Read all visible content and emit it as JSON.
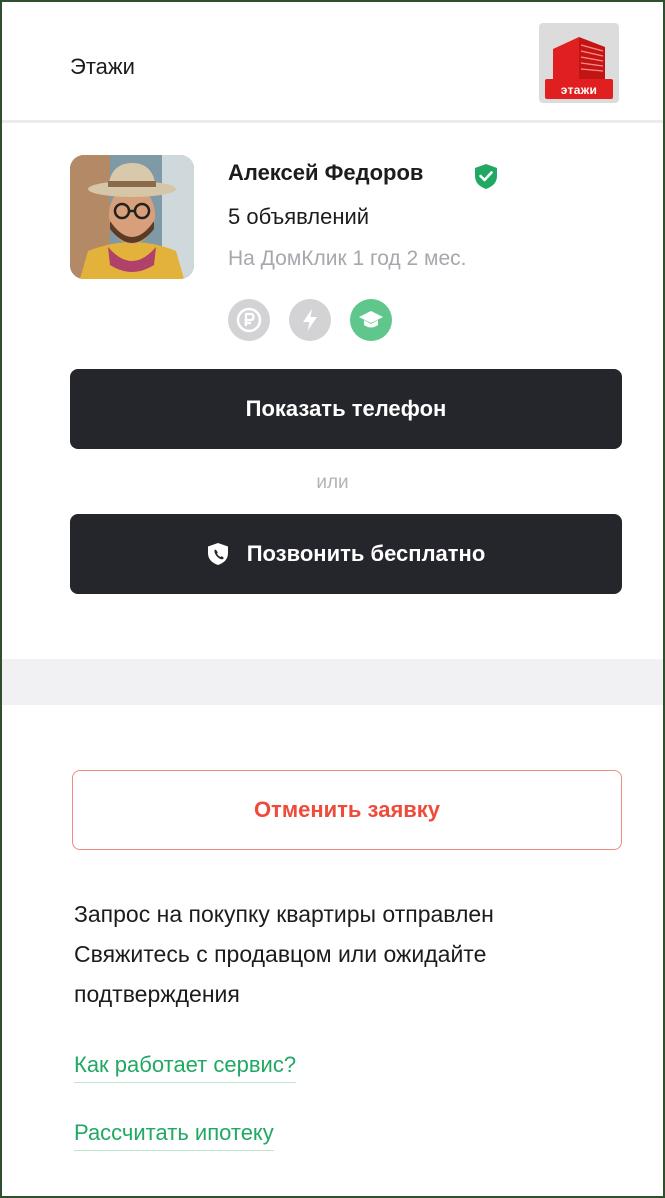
{
  "header": {
    "agency_name": "Этажи",
    "logo_text": "этажи"
  },
  "agent": {
    "name": "Алексей Федоров",
    "listings": "5 объявлений",
    "since": "На ДомКлик 1 год 2 мес.",
    "badges": [
      "ruble-icon",
      "lightning-icon",
      "graduation-cap-icon"
    ]
  },
  "actions": {
    "show_phone": "Показать телефон",
    "or": "или",
    "call_free": "Позвонить бесплатно",
    "cancel_request": "Отменить заявку"
  },
  "message": {
    "line1": "Запрос на покупку квартиры отправлен",
    "line2": "Свяжитесь с продавцом или ожидайте",
    "line3": "подтверждения"
  },
  "links": {
    "how_it_works": "Как работает сервис?",
    "mortgage": "Рассчитать ипотеку"
  },
  "colors": {
    "accent_green": "#21a863",
    "danger_red": "#ee4b3a",
    "dark_button": "#25262b",
    "badge_active": "#5fc78b",
    "badge_inactive": "#d3d3d6"
  }
}
